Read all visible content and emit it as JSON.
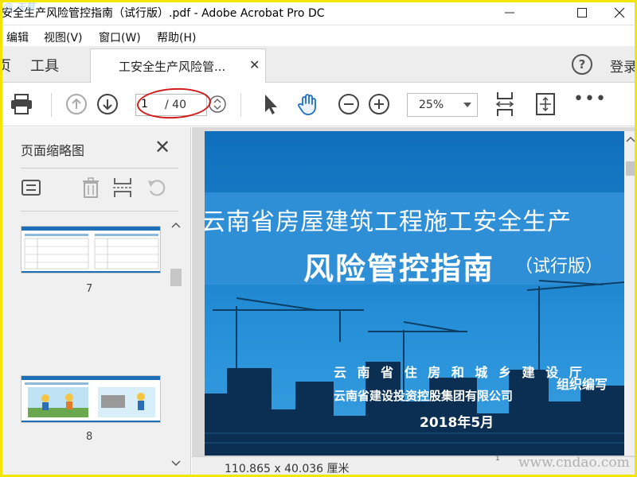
{
  "window": {
    "title": "安全生产风险管控指南（试行版）.pdf - Adobe Acrobat Pro DC",
    "watermark_corner": "@ 天草"
  },
  "menubar": {
    "items": [
      "编辑",
      "视图(V)",
      "窗口(W)",
      "帮助(H)"
    ]
  },
  "tabs": {
    "partial_left": "页",
    "tools": "工具",
    "document": "工安全生产风险管...",
    "login": "登录"
  },
  "toolbar": {
    "page_current": "1",
    "page_total": "/ 40",
    "zoom": "25%"
  },
  "side_panel": {
    "title": "页面缩略图",
    "thumbnails": [
      {
        "page_number": "7"
      },
      {
        "page_number": "8"
      }
    ]
  },
  "document": {
    "title_line1": "云南省房屋建筑工程施工安全生产",
    "title_line2": "风险管控指南",
    "title_line2_suffix": "（试行版）",
    "org_line1": "云 南 省 住 房 和 城 乡 建 设 厅",
    "org_line2": "云南省建设投资控股集团有限公司",
    "org_suffix": "组织编写",
    "date": "2018年5月"
  },
  "status": {
    "dimensions": "110.865 x 40.036 厘米",
    "ruler_tick": "1",
    "watermark": "www.cndao.com"
  },
  "colors": {
    "accent_blue": "#2f8fd6",
    "highlight_red": "#d21a1a",
    "frame_yellow": "#f2e600"
  }
}
